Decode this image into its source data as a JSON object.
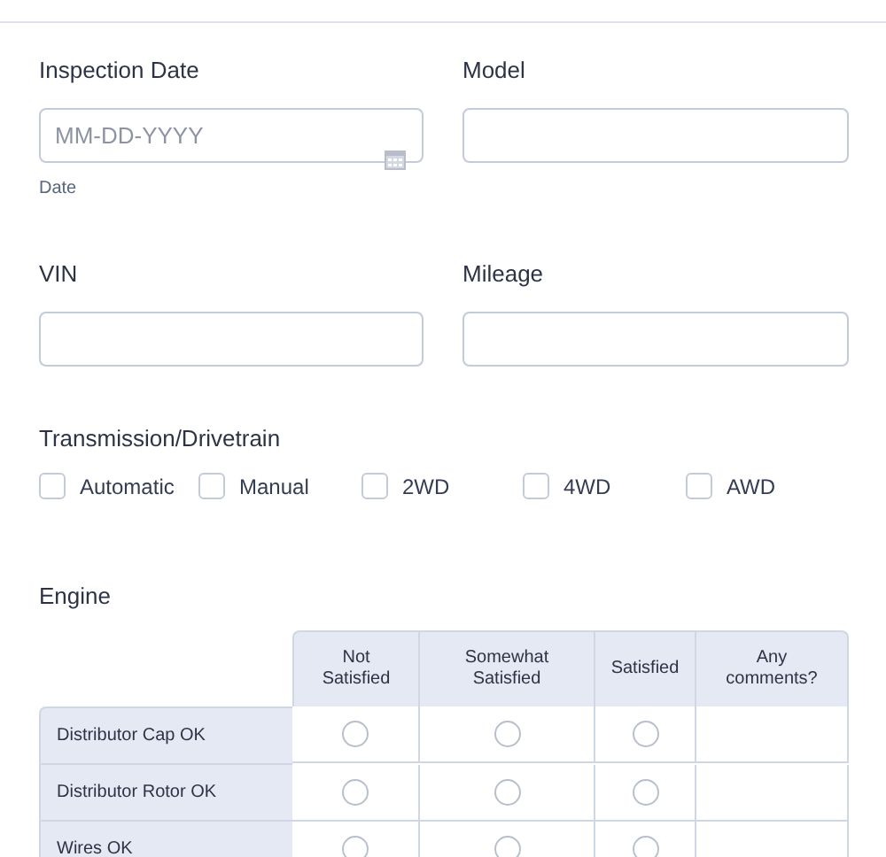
{
  "fields_row_1": [
    {
      "label": "Inspection Date",
      "placeholder": "MM-DD-YYYY",
      "kind": "date",
      "sublabel": "Date"
    },
    {
      "label": "Model",
      "kind": "text"
    }
  ],
  "fields_row_2": [
    {
      "label": "VIN",
      "kind": "text"
    },
    {
      "label": "Mileage",
      "kind": "text"
    }
  ],
  "transmission": {
    "label": "Transmission/Drivetrain",
    "options": [
      {
        "label": "Automatic",
        "checked": false
      },
      {
        "label": "Manual",
        "checked": false
      },
      {
        "label": "2WD",
        "checked": false
      },
      {
        "label": "4WD",
        "checked": false
      },
      {
        "label": "AWD",
        "checked": false
      }
    ]
  },
  "engine": {
    "label": "Engine",
    "columns": [
      "Not Satisfied",
      "Somewhat Satisfied",
      "Satisfied",
      "Any comments?"
    ],
    "rows": [
      {
        "label": "Distributor Cap OK",
        "options": [
          {
            "selected": false
          },
          {
            "selected": false
          },
          {
            "selected": false
          }
        ]
      },
      {
        "label": "Distributor Rotor OK",
        "options": [
          {
            "selected": false
          },
          {
            "selected": false
          },
          {
            "selected": false
          }
        ]
      },
      {
        "label": "Wires OK",
        "options": [
          {
            "selected": false
          },
          {
            "selected": false
          },
          {
            "selected": false
          }
        ]
      }
    ]
  }
}
